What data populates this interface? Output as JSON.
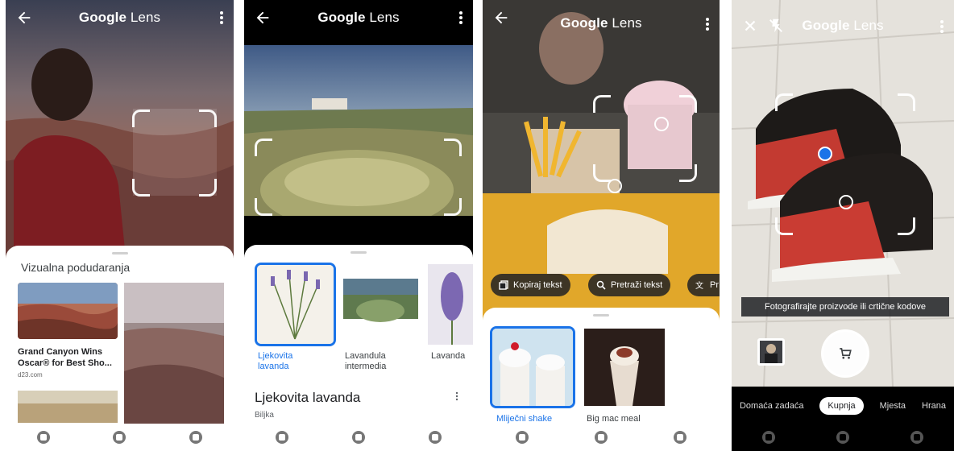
{
  "app_title_bold": "Google",
  "app_title_rest": " Lens",
  "screen1": {
    "section_title": "Vizualna podudaranja",
    "result_label": "Grand Canyon Wins Oscar® for Best Sho...",
    "result_source": "d23.com"
  },
  "screen2": {
    "items": [
      {
        "label": "Ljekovita lavanda"
      },
      {
        "label": "Lavandula intermedia"
      },
      {
        "label": "Lavanda"
      }
    ],
    "result_title": "Ljekovita lavanda",
    "result_subtitle": "Biljka"
  },
  "screen3": {
    "chips": [
      "Kopiraj tekst",
      "Pretraži tekst",
      "Pr"
    ],
    "items": [
      {
        "label": "Mliječni shake"
      },
      {
        "label": "Big mac meal"
      }
    ]
  },
  "screen4": {
    "hint": "Fotografirajte proizvode ili crtične kodove",
    "tabs": [
      "Domaća zadaća",
      "Kupnja",
      "Mjesta",
      "Hrana"
    ]
  },
  "colors": {
    "accent": "#1a73e8",
    "selected_text": "#1a73e8"
  },
  "icons": {
    "back": "arrow-left-icon",
    "menu": "more-vertical-icon",
    "close": "close-icon",
    "flash_off": "flash-off-icon",
    "cart": "shopping-cart-icon"
  }
}
